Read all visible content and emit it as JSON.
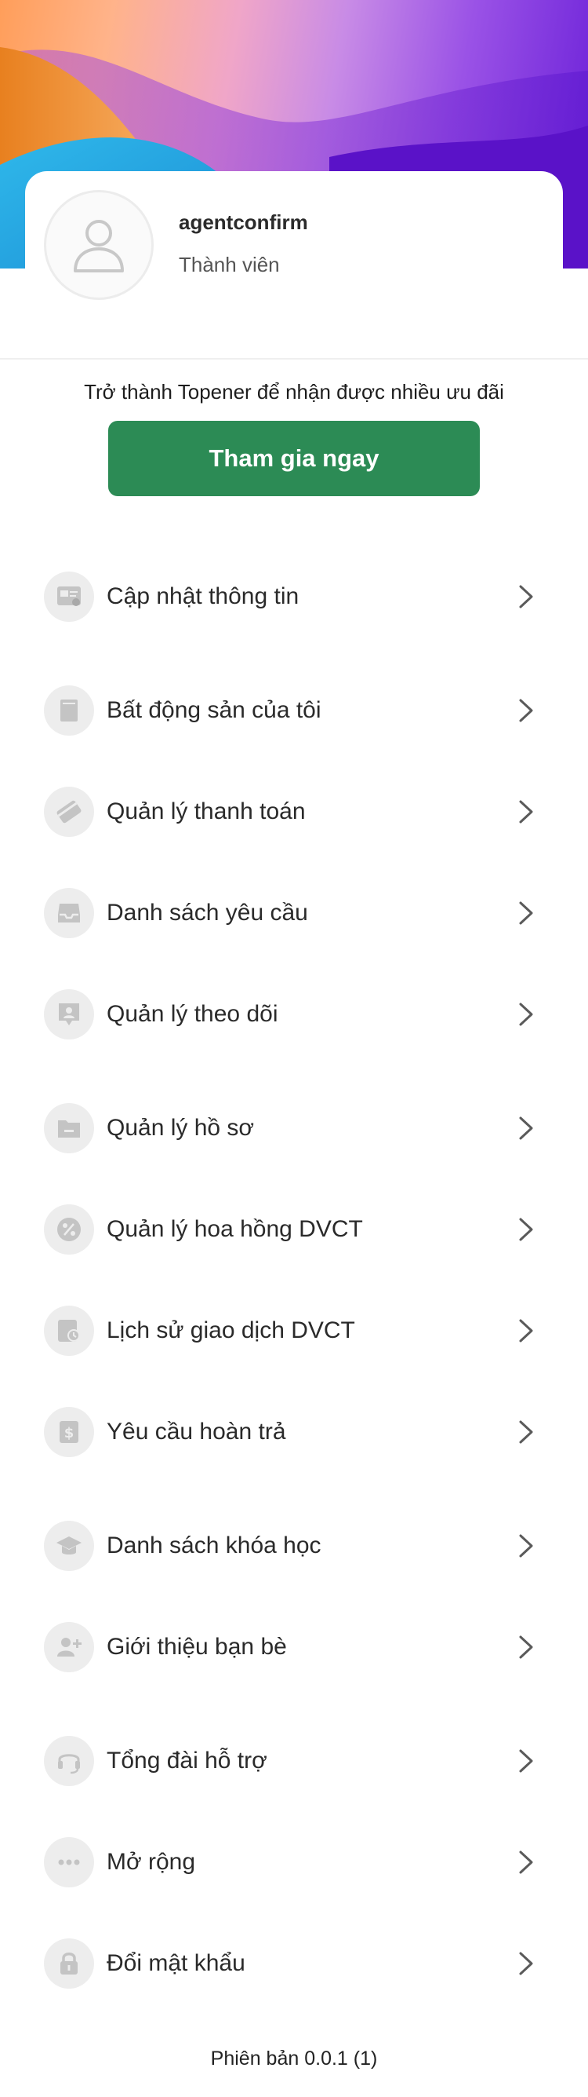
{
  "profile": {
    "username": "agentconfirm",
    "role": "Thành viên"
  },
  "promo": {
    "text": "Trở thành Topener để nhận được nhiều ưu đãi",
    "button_label": "Tham gia ngay"
  },
  "menu": [
    {
      "label": "Cập nhật thông tin",
      "icon": "profile-card-icon"
    },
    {
      "label": "Bất động sản của tôi",
      "icon": "building-icon"
    },
    {
      "label": "Quản lý thanh toán",
      "icon": "credit-card-icon"
    },
    {
      "label": "Danh sách yêu cầu",
      "icon": "inbox-icon"
    },
    {
      "label": "Quản lý theo dõi",
      "icon": "person-chat-icon"
    },
    {
      "label": "Quản lý hồ sơ",
      "icon": "folder-icon"
    },
    {
      "label": "Quản lý hoa hồng DVCT",
      "icon": "percent-icon"
    },
    {
      "label": "Lịch sử giao dịch DVCT",
      "icon": "history-icon"
    },
    {
      "label": "Yêu cầu hoàn trả",
      "icon": "refund-icon"
    },
    {
      "label": "Danh sách khóa học",
      "icon": "graduation-cap-icon"
    },
    {
      "label": "Giới thiệu bạn bè",
      "icon": "add-user-icon"
    },
    {
      "label": "Tổng đài hỗ trợ",
      "icon": "headset-icon"
    },
    {
      "label": "Mở rộng",
      "icon": "more-dots-icon"
    },
    {
      "label": "Đổi mật khẩu",
      "icon": "lock-icon"
    }
  ],
  "version": "Phiên bản 0.0.1 (1)",
  "colors": {
    "primary_button": "#2c8b55",
    "icon_background": "#ededed",
    "icon_foreground": "#c4c4c4"
  }
}
